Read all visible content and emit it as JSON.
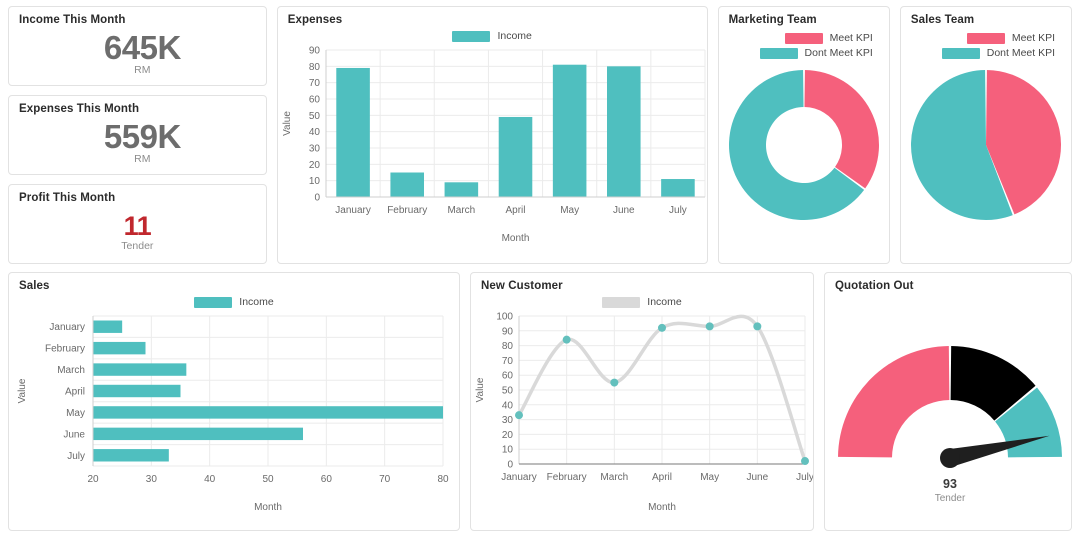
{
  "colors": {
    "teal": "#4fbfbf",
    "pink": "#f5607c",
    "yellow": "#fcc košt"
  },
  "kpi": [
    {
      "title": "Income This Month",
      "value": "645K",
      "unit": "RM",
      "accent": "gray"
    },
    {
      "title": "Expenses This Month",
      "value": "559K",
      "unit": "RM",
      "accent": "gray"
    },
    {
      "title": "Profit This Month",
      "value": "11",
      "unit": "Tender",
      "accent": "red"
    }
  ],
  "expenses": {
    "title": "Expenses",
    "legend": [
      {
        "label": "Income",
        "color": "#4fbfbf"
      }
    ]
  },
  "marketing": {
    "title": "Marketing Team",
    "legend": [
      {
        "label": "Meet KPI",
        "color": "#f5607c"
      },
      {
        "label": "Dont Meet KPI",
        "color": "#4fbfbf"
      }
    ]
  },
  "sales_team": {
    "title": "Sales Team",
    "legend": [
      {
        "label": "Meet KPI",
        "color": "#f5607c"
      },
      {
        "label": "Dont Meet KPI",
        "color": "#4fbfbf"
      }
    ]
  },
  "sales": {
    "title": "Sales",
    "legend": [
      {
        "label": "Income",
        "color": "#4fbfbf"
      }
    ]
  },
  "new_customer": {
    "title": "New Customer",
    "legend": [
      {
        "label": "Income",
        "color": "#d9d9d9"
      }
    ]
  },
  "quotation": {
    "title": "Quotation Out",
    "value": "93",
    "unit": "Tender"
  },
  "chart_data": [
    {
      "id": "expenses",
      "type": "bar",
      "title": "Expenses",
      "orientation": "vertical",
      "categories": [
        "January",
        "February",
        "March",
        "April",
        "May",
        "June",
        "July"
      ],
      "series": [
        {
          "name": "Income",
          "values": [
            79,
            15,
            9,
            49,
            81,
            80,
            11
          ],
          "color": "#4fbfbf"
        }
      ],
      "xlabel": "Month",
      "ylabel": "Value",
      "ylim": [
        0,
        90
      ],
      "yticks": [
        0,
        10,
        20,
        30,
        40,
        50,
        60,
        70,
        80,
        90
      ],
      "grid": true,
      "legend_position": "top-center"
    },
    {
      "id": "marketing-team",
      "type": "pie",
      "variant": "donut",
      "title": "Marketing Team",
      "labels": [
        "Meet KPI",
        "Dont Meet KPI"
      ],
      "values": [
        35,
        65
      ],
      "colors": [
        "#f5607c",
        "#4fbfbf"
      ],
      "legend_position": "top-right"
    },
    {
      "id": "sales-team",
      "type": "pie",
      "variant": "pie",
      "title": "Sales Team",
      "labels": [
        "Meet KPI",
        "Dont Meet KPI"
      ],
      "values": [
        44,
        56
      ],
      "colors": [
        "#f5607c",
        "#4fbfbf"
      ],
      "legend_position": "top-right"
    },
    {
      "id": "sales",
      "type": "bar",
      "title": "Sales",
      "orientation": "horizontal",
      "categories": [
        "January",
        "February",
        "March",
        "April",
        "May",
        "June",
        "July"
      ],
      "series": [
        {
          "name": "Income",
          "values": [
            25,
            29,
            36,
            35,
            80,
            56,
            33
          ],
          "color": "#4fbfbf"
        }
      ],
      "xlabel": "Month",
      "ylabel": "Value",
      "xlim": [
        20,
        80
      ],
      "xticks": [
        20,
        30,
        40,
        50,
        60,
        70,
        80
      ],
      "grid": true,
      "legend_position": "top-center"
    },
    {
      "id": "new-customer",
      "type": "line",
      "title": "New Customer",
      "categories": [
        "January",
        "February",
        "March",
        "April",
        "May",
        "June",
        "July"
      ],
      "series": [
        {
          "name": "Income",
          "values": [
            33,
            84,
            55,
            92,
            93,
            93,
            2
          ],
          "color": "#d9d9d9",
          "marker_color": "#63c0bd"
        }
      ],
      "xlabel": "Month",
      "ylabel": "Value",
      "ylim": [
        0,
        100
      ],
      "yticks": [
        0,
        10,
        20,
        30,
        40,
        50,
        60,
        70,
        80,
        90,
        100
      ],
      "grid": true,
      "smooth": true,
      "legend_position": "top-center"
    },
    {
      "id": "quotation-out",
      "type": "gauge",
      "title": "Quotation Out",
      "value": 93,
      "value_label": "93",
      "unit": "Tender",
      "min": 0,
      "max": 100,
      "segments": [
        {
          "color": "#f5607c",
          "from": 0,
          "to": 50
        },
        {
          "color": "#fcc košt",
          "from": 50,
          "to": 78
        },
        {
          "color": "#4fbfbf",
          "from": 78,
          "to": 100
        }
      ]
    }
  ]
}
